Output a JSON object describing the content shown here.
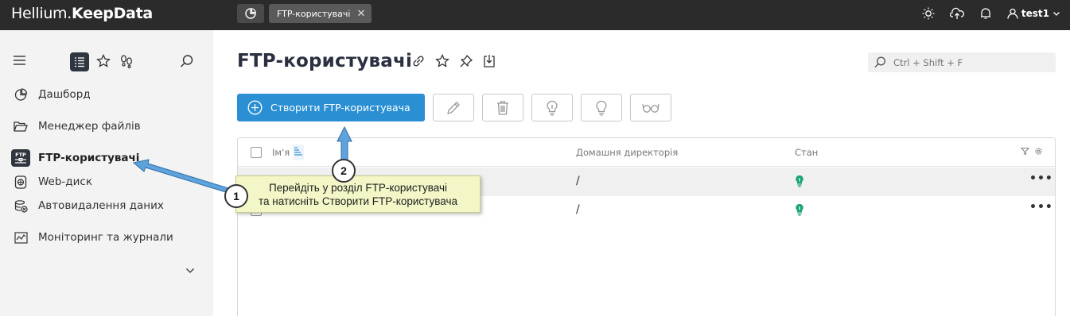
{
  "topbar": {
    "logo_light": "Hellium.",
    "logo_bold": "KeepData",
    "tab_label": "FTP-користувачі",
    "tab_close": "✕",
    "user_name": "test1"
  },
  "sidebar": {
    "items": [
      {
        "label": "Дашборд",
        "icon": "pie-chart-icon"
      },
      {
        "label": "Менеджер файлів",
        "icon": "folder-icon"
      },
      {
        "label": "FTP-користувачі",
        "icon": "ftp-icon"
      },
      {
        "label": "Web-диск",
        "icon": "web-disk-icon"
      },
      {
        "label": "Автовидалення даних",
        "icon": "auto-delete-icon"
      },
      {
        "label": "Моніторинг та журнали",
        "icon": "monitoring-icon"
      }
    ]
  },
  "main": {
    "title": "FTP-користувачі",
    "search_placeholder": "Ctrl + Shift + F",
    "create_button": "Створити FTP-користувача",
    "table": {
      "columns": [
        "Ім'я",
        "Домашня директорія",
        "Стан"
      ],
      "rows": [
        {
          "name": "",
          "home": "/",
          "status": "active"
        },
        {
          "name": "",
          "home": "/",
          "status": "active"
        }
      ]
    }
  },
  "annotation": {
    "callout_line1": "Перейдіть у розділ FTP-користувачі",
    "callout_line2": "та натисніть Створити FTP-користувача",
    "step1": "1",
    "step2": "2"
  },
  "colors": {
    "topbar": "#2b2b2b",
    "primary": "#2b8fd3",
    "status_green": "#1aa37a",
    "callout_bg": "#f3f6c6",
    "arrow": "#4a9ad6"
  }
}
